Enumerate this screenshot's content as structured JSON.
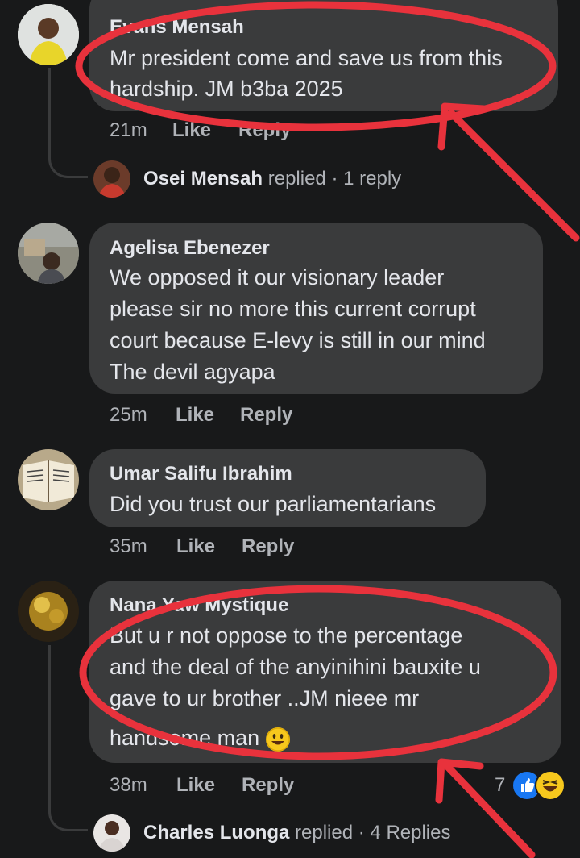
{
  "comments": [
    {
      "name": "Evans Mensah",
      "lines": [
        "Mr president come and save us from this",
        "hardship. JM b3ba 2025"
      ],
      "time": "21m",
      "like": "Like",
      "reply": "Reply"
    },
    {
      "name": "Agelisa Ebenezer",
      "lines": [
        "We opposed it our visionary leader",
        "please sir no more this current corrupt",
        "court because E-levy is still in our mind",
        "The devil agyapa"
      ],
      "time": "25m",
      "like": "Like",
      "reply": "Reply"
    },
    {
      "name": "Umar Salifu Ibrahim",
      "lines": [
        "Did you trust our parliamentarians"
      ],
      "time": "35m",
      "like": "Like",
      "reply": "Reply"
    },
    {
      "name": "Nana Yaw Mystique",
      "lines": [
        "But u r not oppose to the percentage",
        "and the deal of the anyinihini bauxite  u",
        "gave to ur brother ..JM nieee mr",
        "handsome man"
      ],
      "time": "38m",
      "like": "Like",
      "reply": "Reply",
      "reaction_count": "7"
    }
  ],
  "replies": [
    {
      "name": "Osei Mensah",
      "action": "replied",
      "sep": "·",
      "count": "1 reply"
    },
    {
      "name": "Charles Luonga",
      "action": "replied",
      "sep": "·",
      "count": "4 Replies"
    }
  ],
  "colors": {
    "background": "#18191a",
    "bubble": "#3a3b3c",
    "annotation": "#e8323c",
    "like_blue": "#1877f2",
    "emoji_yellow": "#f7c81d"
  },
  "icons": [
    "like-reaction-icon",
    "haha-reaction-icon",
    "smile-emoji-icon"
  ]
}
